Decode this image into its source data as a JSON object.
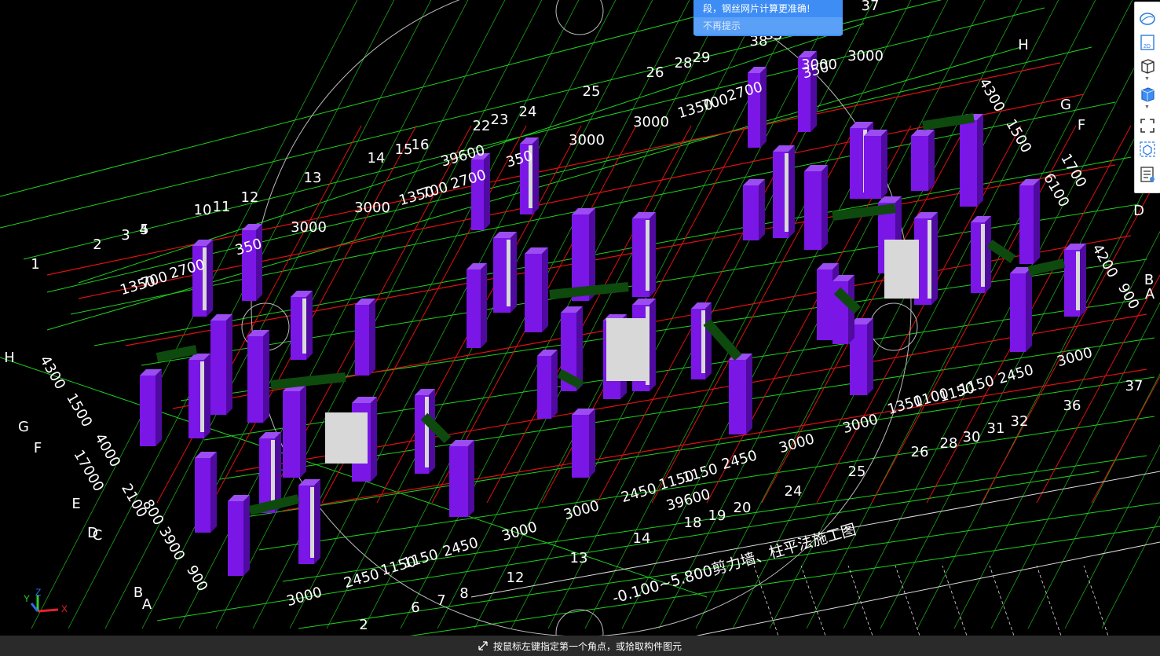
{
  "toast": {
    "message": "段，钢丝网片计算更准确!",
    "dismiss_label": "不再提示"
  },
  "toolbar": {
    "buttons": [
      {
        "name": "dynamic-observe-icon"
      },
      {
        "name": "view-2d-icon",
        "label": "2D"
      },
      {
        "name": "view-3d-icon"
      },
      {
        "name": "solid-view-icon"
      },
      {
        "name": "full-screen-icon"
      },
      {
        "name": "component-display-icon"
      },
      {
        "name": "properties-list-icon"
      }
    ]
  },
  "status_bar": {
    "prompt": "按鼠标左键指定第一个角点，或拾取构件图元"
  },
  "drawing": {
    "title": "-0.100~5.800剪力墙、柱平法施工图",
    "axis_x": "X",
    "axis_y": "Y",
    "axis_z": "Z",
    "colors": {
      "background": "#000000",
      "grid_green": "#1fd11f",
      "axis_red": "#e01010",
      "wall_purple": "#7a16e6",
      "beam_green": "#0e4a0e",
      "label_white": "#ffffff",
      "toast_blue": "#3d8df5"
    },
    "dim_labels": [
      {
        "text": "37"
      },
      {
        "text": "H"
      },
      {
        "text": "3000"
      },
      {
        "text": "38"
      },
      {
        "text": "35"
      },
      {
        "text": "28"
      },
      {
        "text": "29"
      },
      {
        "text": "26"
      },
      {
        "text": "25"
      },
      {
        "text": "24"
      },
      {
        "text": "22"
      },
      {
        "text": "23"
      },
      {
        "text": "1350"
      },
      {
        "text": "700"
      },
      {
        "text": "2700"
      },
      {
        "text": "350"
      },
      {
        "text": "3000"
      },
      {
        "text": "3000"
      },
      {
        "text": "4300"
      },
      {
        "text": "G"
      },
      {
        "text": "1500"
      },
      {
        "text": "F"
      },
      {
        "text": "1700"
      },
      {
        "text": "6100"
      },
      {
        "text": "D"
      },
      {
        "text": "4200"
      },
      {
        "text": "B"
      },
      {
        "text": "900"
      },
      {
        "text": "A"
      },
      {
        "text": "39600"
      },
      {
        "text": "15"
      },
      {
        "text": "16"
      },
      {
        "text": "14"
      },
      {
        "text": "13"
      },
      {
        "text": "3000"
      },
      {
        "text": "1350"
      },
      {
        "text": "700"
      },
      {
        "text": "2700"
      },
      {
        "text": "350"
      },
      {
        "text": "10"
      },
      {
        "text": "11"
      },
      {
        "text": "12"
      },
      {
        "text": "3000"
      },
      {
        "text": "1350"
      },
      {
        "text": "700"
      },
      {
        "text": "2700"
      },
      {
        "text": "350"
      },
      {
        "text": "2"
      },
      {
        "text": "3"
      },
      {
        "text": "4"
      },
      {
        "text": "5"
      },
      {
        "text": "1"
      },
      {
        "text": "3000"
      },
      {
        "text": "H"
      },
      {
        "text": "4300"
      },
      {
        "text": "1500"
      },
      {
        "text": "G"
      },
      {
        "text": "F"
      },
      {
        "text": "4000"
      },
      {
        "text": "17000"
      },
      {
        "text": "E"
      },
      {
        "text": "2100"
      },
      {
        "text": "800"
      },
      {
        "text": "D"
      },
      {
        "text": "C"
      },
      {
        "text": "3900"
      },
      {
        "text": "900"
      },
      {
        "text": "B"
      },
      {
        "text": "A"
      },
      {
        "text": "3000"
      },
      {
        "text": "2"
      },
      {
        "text": "6"
      },
      {
        "text": "7"
      },
      {
        "text": "8"
      },
      {
        "text": "2450"
      },
      {
        "text": "1150"
      },
      {
        "text": "1150"
      },
      {
        "text": "2450"
      },
      {
        "text": "12"
      },
      {
        "text": "13"
      },
      {
        "text": "3000"
      },
      {
        "text": "14"
      },
      {
        "text": "3000"
      },
      {
        "text": "2450"
      },
      {
        "text": "1150"
      },
      {
        "text": "1150"
      },
      {
        "text": "2450"
      },
      {
        "text": "18"
      },
      {
        "text": "19"
      },
      {
        "text": "20"
      },
      {
        "text": "39600"
      },
      {
        "text": "24"
      },
      {
        "text": "3000"
      },
      {
        "text": "25"
      },
      {
        "text": "3000"
      },
      {
        "text": "26"
      },
      {
        "text": "28"
      },
      {
        "text": "30"
      },
      {
        "text": "31"
      },
      {
        "text": "32"
      },
      {
        "text": "1350"
      },
      {
        "text": "1100"
      },
      {
        "text": "1150"
      },
      {
        "text": "1150"
      },
      {
        "text": "2450"
      },
      {
        "text": "3000"
      },
      {
        "text": "36"
      },
      {
        "text": "37"
      }
    ]
  }
}
